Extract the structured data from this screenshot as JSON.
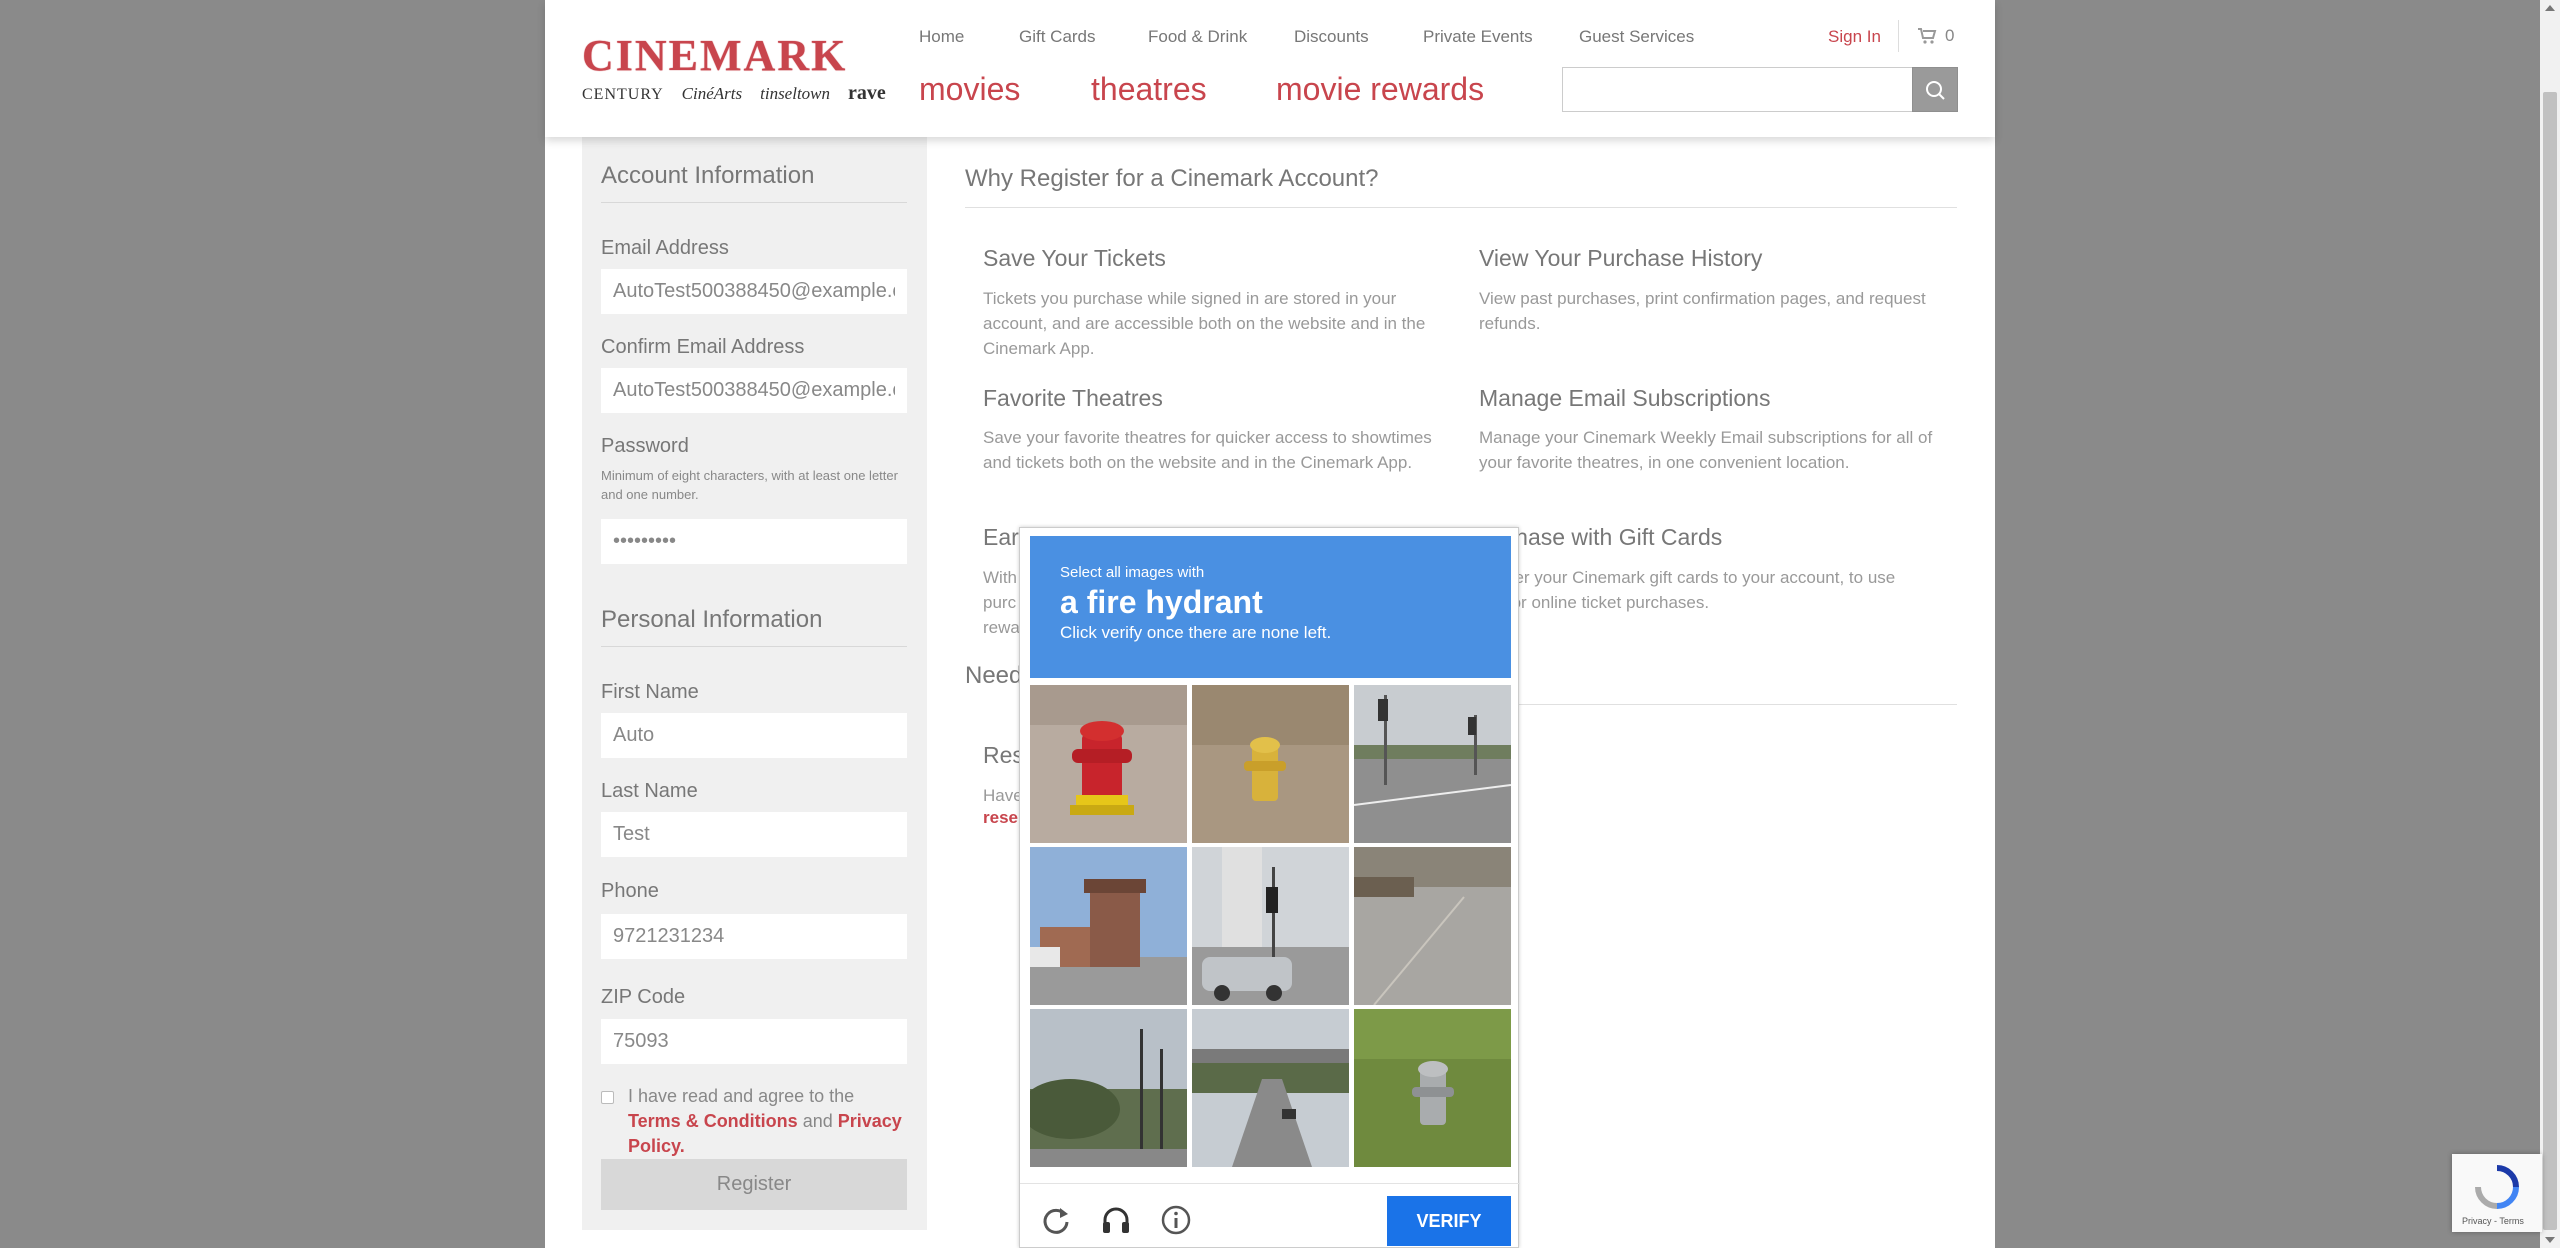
{
  "header": {
    "logo": {
      "wordmark": "CINEMARK",
      "subbrands": [
        "CENTURY",
        "CinéArts",
        "tinseltown",
        "rave"
      ]
    },
    "top_links": [
      "Home",
      "Gift Cards",
      "Food & Drink",
      "Discounts",
      "Private Events",
      "Guest Services"
    ],
    "main_links": [
      "movies",
      "theatres",
      "movie rewards"
    ],
    "sign_in": "Sign In",
    "cart_count": "0",
    "search": {
      "value": "",
      "placeholder": ""
    }
  },
  "form": {
    "account_title": "Account Information",
    "email_label": "Email Address",
    "email_value": "AutoTest500388450@example.c",
    "confirm_email_label": "Confirm Email Address",
    "confirm_email_value": "AutoTest500388450@example.c",
    "password_label": "Password",
    "password_hint": "Minimum of eight characters, with at least one letter and one number.",
    "password_value": "•••••••••",
    "personal_title": "Personal Information",
    "first_name_label": "First Name",
    "first_name_value": "Auto",
    "last_name_label": "Last Name",
    "last_name_value": "Test",
    "phone_label": "Phone",
    "phone_value": "9721231234",
    "zip_label": "ZIP Code",
    "zip_value": "75093",
    "terms_prefix": "I have read and agree to the ",
    "terms_link": "Terms & Conditions",
    "terms_and": " and ",
    "privacy_link": "Privacy Policy.",
    "register_label": "Register"
  },
  "why": {
    "title": "Why Register for a Cinemark Account?",
    "features": [
      {
        "title": "Save Your Tickets",
        "text": "Tickets you purchase while signed in are stored in your account, and are accessible both on the website and in the Cinemark App."
      },
      {
        "title": "View Your Purchase History",
        "text": "View past purchases, print confirmation pages, and request refunds."
      },
      {
        "title": "Favorite Theatres",
        "text": "Save your favorite theatres for quicker access to showtimes and tickets both on the website and in the Cinemark App."
      },
      {
        "title": "Manage Email Subscriptions",
        "text": "Manage your Cinemark Weekly Email subscriptions for all of your favorite theatres, in one convenient location."
      }
    ],
    "partial_left_title": "Earn",
    "partial_left_lines": [
      "With",
      "purc",
      "rewa"
    ],
    "partial_right_title": "rchase with Gift Cards",
    "partial_right_lines": [
      "gister your Cinemark gift cards to your account, to use",
      "m for online ticket purchases."
    ],
    "need_title": "Need",
    "res_title": "Res",
    "res_line": "Have",
    "res_link": "rese"
  },
  "captcha": {
    "instruction_small": "Select all images with",
    "target": "a fire hydrant",
    "instruction_sub": "Click verify once there are none left.",
    "verify_label": "VERIFY",
    "icons": [
      "reload-icon",
      "audio-headphones-icon",
      "info-icon"
    ],
    "accent": "#4a90e2"
  },
  "badge": {
    "text": "Privacy - Terms"
  },
  "colors": {
    "brand": "#c8454d",
    "overlay": "#8a8a8a",
    "verify": "#1a73e8"
  }
}
